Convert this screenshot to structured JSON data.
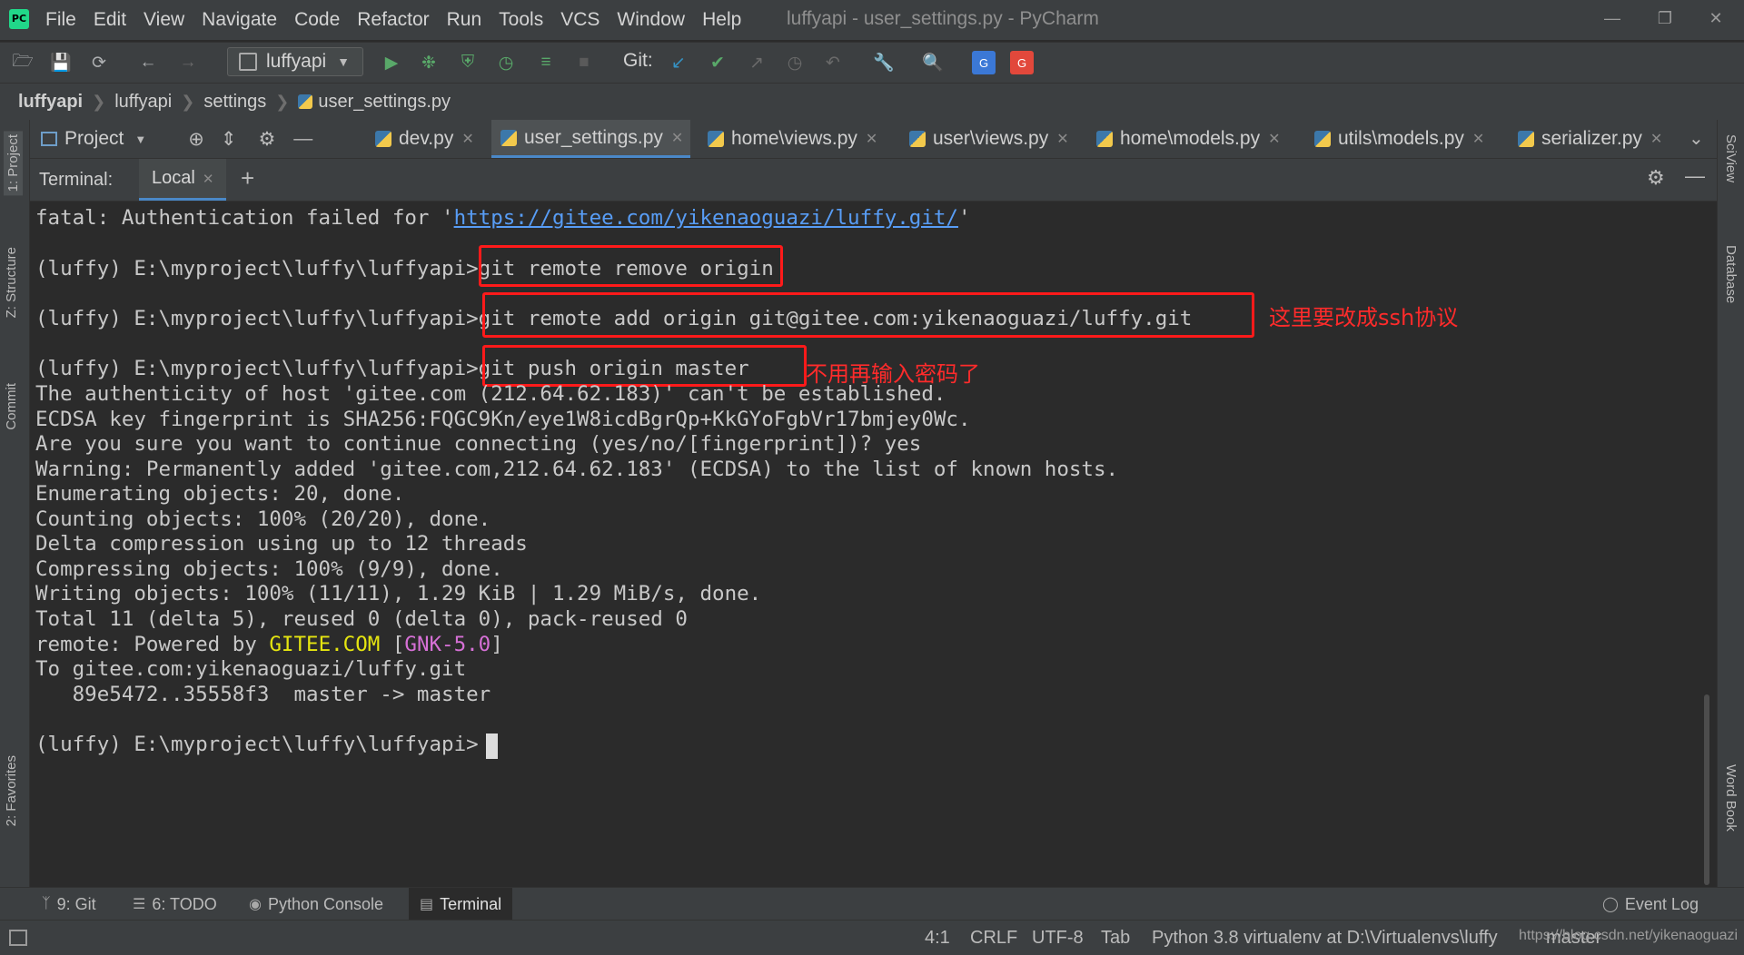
{
  "window": {
    "title": "luffyapi - user_settings.py - PyCharm",
    "logo_text": "PC"
  },
  "menu": [
    "File",
    "Edit",
    "View",
    "Navigate",
    "Code",
    "Refactor",
    "Run",
    "Tools",
    "VCS",
    "Window",
    "Help"
  ],
  "toolbar": {
    "run_config": "luffyapi",
    "git_label": "Git:"
  },
  "breadcrumb": [
    "luffyapi",
    "luffyapi",
    "settings",
    "user_settings.py"
  ],
  "left_stripe": [
    "1: Project",
    "Z: Structure",
    "Commit",
    "2: Favorites"
  ],
  "right_stripe": [
    "SciView",
    "Database",
    "Word Book"
  ],
  "project_panel": {
    "label": "Project"
  },
  "tabs": [
    {
      "name": "dev.py"
    },
    {
      "name": "user_settings.py",
      "active": true
    },
    {
      "name": "home\\views.py"
    },
    {
      "name": "user\\views.py"
    },
    {
      "name": "home\\models.py"
    },
    {
      "name": "utils\\models.py"
    },
    {
      "name": "serializer.py"
    }
  ],
  "terminal": {
    "header_label": "Terminal:",
    "session_tab": "Local",
    "lines": {
      "l1a": "fatal: Authentication failed for '",
      "l1link": "https://gitee.com/yikenaoguazi/luffy.git/",
      "l1b": "'",
      "prompt": "(luffy) E:\\myproject\\luffy\\luffyapi>",
      "cmd1": "git remote remove origin",
      "cmd2": "git remote add origin git@gitee.com:yikenaoguazi/luffy.git",
      "cmd3": "git push origin master",
      "o1": "The authenticity of host 'gitee.com (212.64.62.183)' can't be established.",
      "o2": "ECDSA key fingerprint is SHA256:FQGC9Kn/eye1W8icdBgrQp+KkGYoFgbVr17bmjey0Wc.",
      "o3": "Are you sure you want to continue connecting (yes/no/[fingerprint])? yes",
      "o4": "Warning: Permanently added 'gitee.com,212.64.62.183' (ECDSA) to the list of known hosts.",
      "o5": "Enumerating objects: 20, done.",
      "o6": "Counting objects: 100% (20/20), done.",
      "o7": "Delta compression using up to 12 threads",
      "o8": "Compressing objects: 100% (9/9), done.",
      "o9": "Writing objects: 100% (11/11), 1.29 KiB | 1.29 MiB/s, done.",
      "o10": "Total 11 (delta 5), reused 0 (delta 0), pack-reused 0",
      "o11a": "remote: Powered by ",
      "o11b": "GITEE.COM",
      "o11c": " [",
      "o11d": "GNK-5.0",
      "o11e": "]",
      "o12": "To gitee.com:yikenaoguazi/luffy.git",
      "o13": "   89e5472..35558f3  master -> master"
    },
    "annotations": {
      "ssh_note": "这里要改成ssh协议",
      "no_password_note": "不用再输入密码了"
    }
  },
  "bottom_tools": {
    "git": "9: Git",
    "todo": "6: TODO",
    "python_console": "Python Console",
    "terminal": "Terminal",
    "event_log": "Event Log"
  },
  "status": {
    "position": "4:1",
    "line_sep": "CRLF",
    "encoding": "UTF-8",
    "indent": "Tab",
    "interpreter": "Python 3.8 virtualenv at D:\\Virtualenvs\\luffy",
    "branch": "master",
    "watermark": "https://blog.csdn.net/yikenaoguazi"
  },
  "colors": {
    "annotation": "#ff1a1a",
    "link": "#589df6",
    "accent": "#4a88c7"
  }
}
